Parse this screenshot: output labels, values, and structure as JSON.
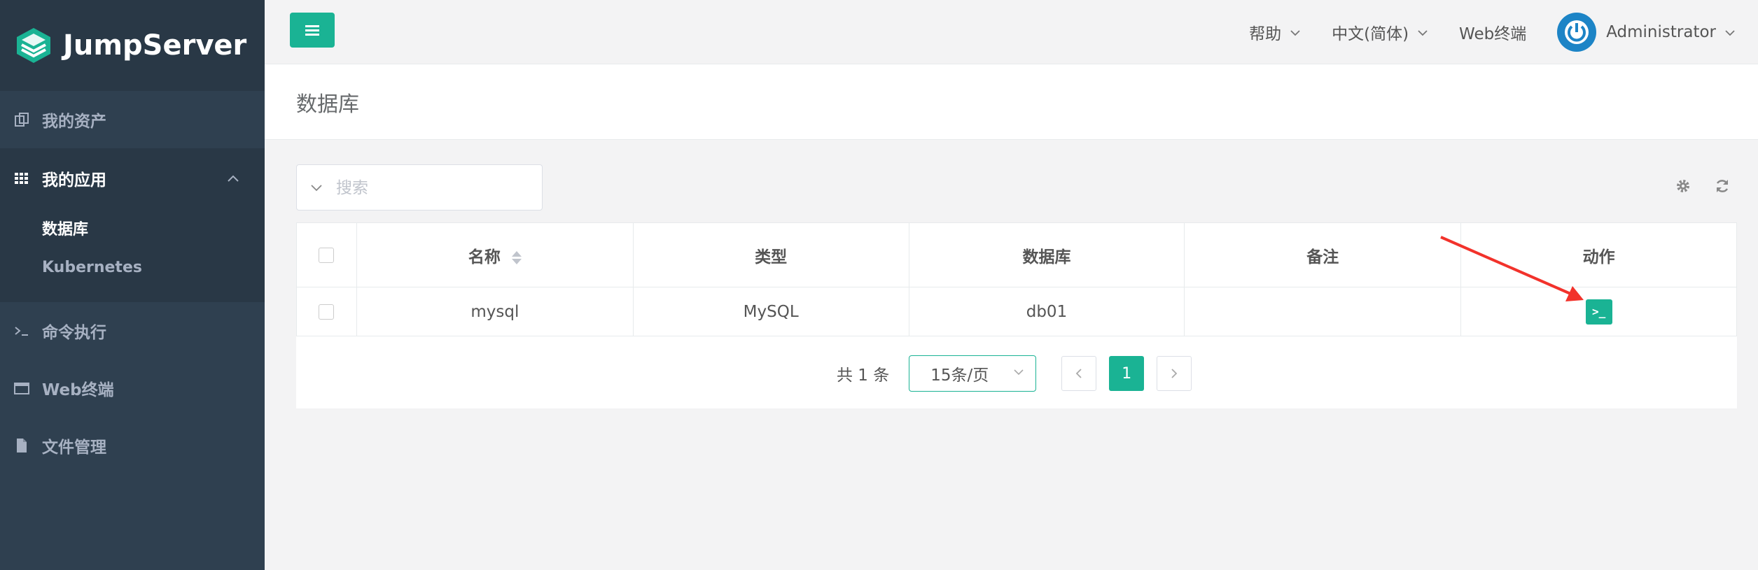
{
  "brand": {
    "name": "JumpServer",
    "accent": "#1ab394",
    "sidebar_bg": "#2f4050"
  },
  "sidebar": {
    "items": [
      {
        "label": "我的资产",
        "icon": "assets-icon"
      },
      {
        "label": "我的应用",
        "icon": "grid-icon",
        "expanded": true,
        "children": [
          {
            "label": "数据库",
            "active": true
          },
          {
            "label": "Kubernetes"
          }
        ]
      },
      {
        "label": "命令执行",
        "icon": "terminal-prompt-icon"
      },
      {
        "label": "Web终端",
        "icon": "window-icon"
      },
      {
        "label": "文件管理",
        "icon": "file-icon"
      }
    ]
  },
  "topbar": {
    "help": "帮助",
    "language": "中文(简体)",
    "web_terminal": "Web终端",
    "user": "Administrator"
  },
  "page": {
    "title": "数据库"
  },
  "search": {
    "placeholder": "搜索",
    "value": ""
  },
  "table": {
    "columns": [
      "名称",
      "类型",
      "数据库",
      "备注",
      "动作"
    ],
    "rows": [
      {
        "name": "mysql",
        "type": "MySQL",
        "database": "db01",
        "comment": ""
      }
    ]
  },
  "pagination": {
    "total_text": "共 1 条",
    "page_size": "15条/页",
    "current_page": "1"
  },
  "action_button": {
    "label": ">_"
  }
}
